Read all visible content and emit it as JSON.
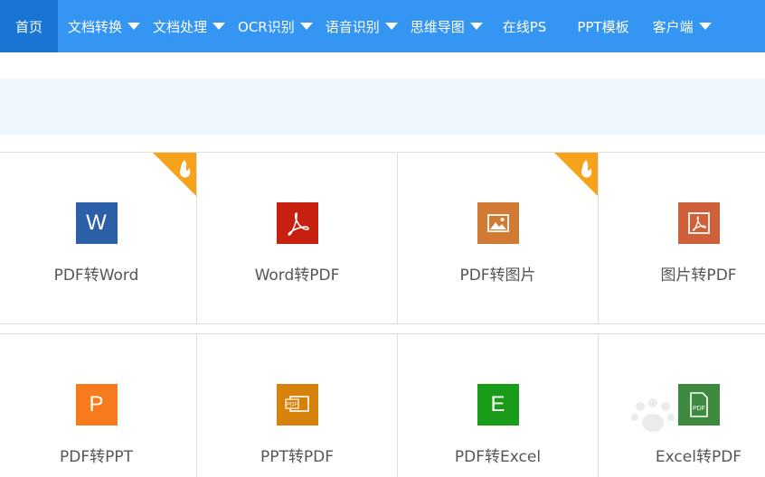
{
  "nav": {
    "items": [
      {
        "label": "首页",
        "active": true,
        "dropdown": false
      },
      {
        "label": "文档转换",
        "active": false,
        "dropdown": true
      },
      {
        "label": "文档处理",
        "active": false,
        "dropdown": true
      },
      {
        "label": "OCR识别",
        "active": false,
        "dropdown": true
      },
      {
        "label": "语音识别",
        "active": false,
        "dropdown": true
      },
      {
        "label": "思维导图",
        "active": false,
        "dropdown": true
      },
      {
        "label": "在线PS",
        "active": false,
        "dropdown": false
      },
      {
        "label": "PPT模板",
        "active": false,
        "dropdown": false
      },
      {
        "label": "客户端",
        "active": false,
        "dropdown": true
      }
    ]
  },
  "tools": [
    {
      "label": "PDF转Word",
      "icon": "word-icon",
      "glyph": "W",
      "color": "#2b5fa8",
      "hot": true
    },
    {
      "label": "Word转PDF",
      "icon": "pdf-icon",
      "glyph": "",
      "color": "#c8200e",
      "hot": false
    },
    {
      "label": "PDF转图片",
      "icon": "image-icon",
      "glyph": "",
      "color": "#d17a33",
      "hot": true
    },
    {
      "label": "图片转PDF",
      "icon": "pdf-icon",
      "glyph": "",
      "color": "#d0603a",
      "hot": false
    },
    {
      "label": "PDF转PPT",
      "icon": "powerpoint-icon",
      "glyph": "P",
      "color": "#f77b1c",
      "hot": false
    },
    {
      "label": "PPT转PDF",
      "icon": "ppt-pdf-icon",
      "glyph": "",
      "color": "#d6820a",
      "hot": false
    },
    {
      "label": "PDF转Excel",
      "icon": "excel-icon",
      "glyph": "E",
      "color": "#1a9c1a",
      "hot": false
    },
    {
      "label": "Excel转PDF",
      "icon": "excel-pdf-icon",
      "glyph": "",
      "color": "#3e8a3e",
      "hot": false
    }
  ],
  "colors": {
    "nav_bg": "#3595f2",
    "nav_active": "#1875d4",
    "hot_orange": "#f7a21b"
  }
}
